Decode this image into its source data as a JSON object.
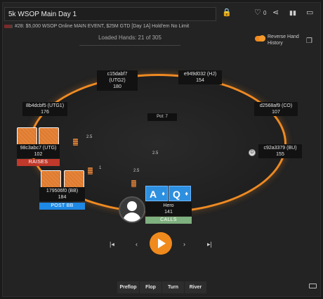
{
  "header": {
    "title": "5k WSOP Main Day 1",
    "subtitle": "#28: $5,000 WSOP Online MAIN EVENT, $25M GTD [Day 1A] Hold'em No Limit",
    "like_count": "0"
  },
  "loaded_hands": "Loaded Hands: 21 of 305",
  "reverse_history_label": "Reverse Hand History",
  "pot_label": "Pot: 7",
  "seats": {
    "utg2": {
      "name": "c15dabf7 (UTG2)",
      "stack": "180"
    },
    "hj": {
      "name": "e949d032 (HJ)",
      "stack": "154"
    },
    "utg1": {
      "name": "8b4dcbf5 (UTG1)",
      "stack": "176"
    },
    "co": {
      "name": "d2568af9 (CO)",
      "stack": "107"
    },
    "utg": {
      "name": "98c3abc7 (UTG)",
      "stack": "102",
      "action": "RAISES"
    },
    "bu": {
      "name": "c92a3379 (BU)",
      "stack": "155"
    },
    "bb": {
      "name": "179506f0 (BB)",
      "stack": "184",
      "action": "POST BB"
    },
    "hero": {
      "name": "Hero",
      "stack": "141",
      "action": "CALLS"
    }
  },
  "bets": {
    "utg": "2.5",
    "center": "2.5",
    "bb": "1",
    "hero": "2.5"
  },
  "hero_cards": [
    {
      "rank": "A",
      "suit": "♦"
    },
    {
      "rank": "Q",
      "suit": "♦"
    }
  ],
  "dealer_button": "D",
  "streets": [
    "Preflop",
    "Flop",
    "Turn",
    "River"
  ],
  "colors": {
    "accent": "#f08a1c",
    "raise_tag": "#c0392b",
    "post_tag": "#1e88e5",
    "call_tag": "#7fb07f",
    "hero_card": "#2d8fe0"
  }
}
